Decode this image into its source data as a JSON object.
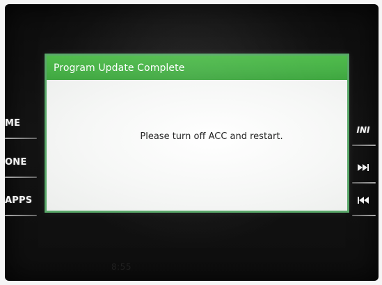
{
  "dialog": {
    "title": "Program Update Complete",
    "message": "Please turn off ACC and restart.",
    "accent_color": "#4fbc4b"
  },
  "hardware": {
    "left_buttons": [
      "ME",
      "ONE",
      "APPS"
    ],
    "right_buttons": {
      "info_label": "INI",
      "next_icon": "skip-forward-icon",
      "prev_icon": "skip-back-icon"
    }
  },
  "status": {
    "clock": "8:55"
  }
}
